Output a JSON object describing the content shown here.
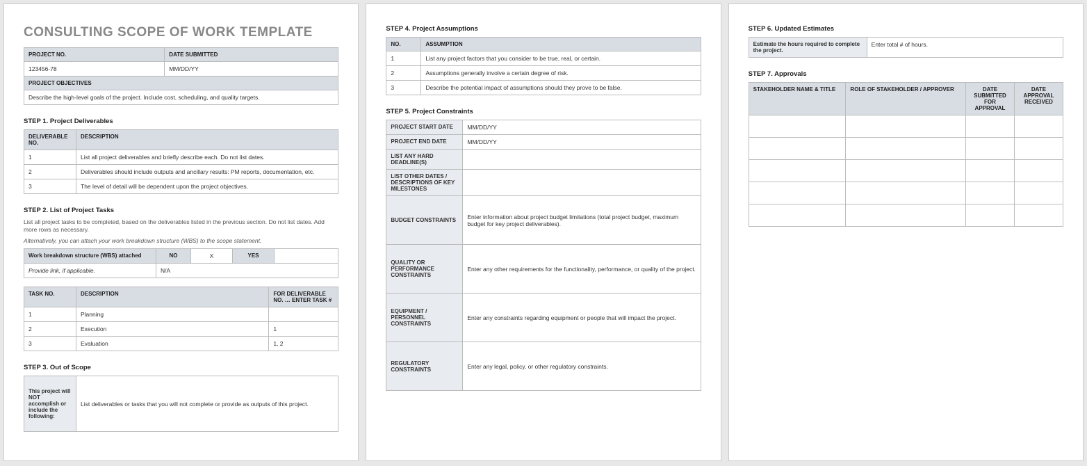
{
  "title": "CONSULTING SCOPE OF WORK TEMPLATE",
  "projInfo": {
    "projectNo_h": "PROJECT NO.",
    "dateSubmitted_h": "DATE SUBMITTED",
    "projectNo": "123456-78",
    "dateSubmitted": "MM/DD/YY",
    "objectives_h": "PROJECT OBJECTIVES",
    "objectives": "Describe the high-level goals of the project. Include cost, scheduling, and quality targets."
  },
  "step1": {
    "title": "STEP 1. Project Deliverables",
    "h1": "DELIVERABLE NO.",
    "h2": "DESCRIPTION",
    "rows": [
      {
        "n": "1",
        "d": "List all project deliverables and briefly describe each. Do not list dates."
      },
      {
        "n": "2",
        "d": "Deliverables should include outputs and ancillary results: PM reports, documentation, etc."
      },
      {
        "n": "3",
        "d": "The level of detail will be dependent upon the project objectives."
      }
    ]
  },
  "step2": {
    "title": "STEP 2. List of Project Tasks",
    "desc": "List all project tasks to be completed, based on the deliverables listed in the previous section. Do not list dates. Add more rows as necessary.",
    "italic": "Alternatively, you can attach your work breakdown structure (WBS) to the scope statement.",
    "wbs_h": "Work breakdown structure (WBS) attached",
    "no": "NO",
    "x": "X",
    "yes": "YES",
    "link_label": "Provide link, if applicable.",
    "link_val": "N/A",
    "h1": "TASK NO.",
    "h2": "DESCRIPTION",
    "h3": "FOR DELIVERABLE NO. … ENTER TASK #",
    "rows": [
      {
        "n": "1",
        "d": "Planning",
        "f": ""
      },
      {
        "n": "2",
        "d": "Execution",
        "f": "1"
      },
      {
        "n": "3",
        "d": "Evaluation",
        "f": "1, 2"
      }
    ]
  },
  "step3": {
    "title": "STEP 3. Out of Scope",
    "label": "This project will NOT accomplish or include the following:",
    "label_pre": "This project will ",
    "label_bold": "NOT accomplish",
    "label_post": " or include the following:",
    "val": "List deliverables or tasks that you will not complete or provide as outputs of this project."
  },
  "step4": {
    "title": "STEP 4. Project Assumptions",
    "h1": "NO.",
    "h2": "ASSUMPTION",
    "rows": [
      {
        "n": "1",
        "d": "List any project factors that you consider to be true, real, or certain."
      },
      {
        "n": "2",
        "d": "Assumptions generally involve a certain degree of risk."
      },
      {
        "n": "3",
        "d": "Describe the potential impact of assumptions should they prove to be false."
      }
    ]
  },
  "step5": {
    "title": "STEP 5. Project Constraints",
    "startDate_h": "PROJECT START DATE",
    "startDate": "MM/DD/YY",
    "endDate_h": "PROJECT END DATE",
    "endDate": "MM/DD/YY",
    "deadlines_h": "LIST ANY HARD DEADLINE(S)",
    "milestones_h": "LIST OTHER DATES / DESCRIPTIONS OF KEY MILESTONES",
    "budget_h": "BUDGET CONSTRAINTS",
    "budget": "Enter information about project budget limitations (total project budget, maximum budget for key project deliverables).",
    "quality_h": "QUALITY OR PERFORMANCE CONSTRAINTS",
    "quality": "Enter any other requirements for the functionality, performance, or quality of the project.",
    "equip_h": "EQUIPMENT / PERSONNEL CONSTRAINTS",
    "equip": "Enter any constraints regarding equipment or people that will impact the project.",
    "reg_h": "REGULATORY CONSTRAINTS",
    "reg": "Enter any legal, policy, or other regulatory constraints."
  },
  "step6": {
    "title": "STEP 6. Updated Estimates",
    "label": "Estimate the hours required to complete the project.",
    "val": "Enter total # of hours."
  },
  "step7": {
    "title": "STEP 7. Approvals",
    "h1": "STAKEHOLDER NAME & TITLE",
    "h2": "ROLE OF STAKEHOLDER / APPROVER",
    "h3": "DATE SUBMITTED FOR APPROVAL",
    "h4": "DATE APPROVAL RECEIVED"
  }
}
